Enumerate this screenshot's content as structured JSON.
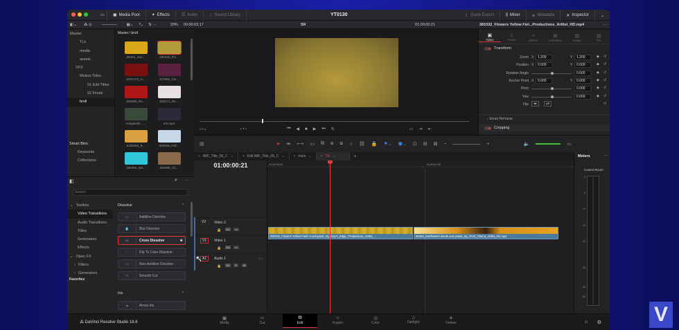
{
  "titlebar": {
    "project": "YT0130",
    "tabs_left": [
      "Media Pool",
      "Effects",
      "Index",
      "Sound Library"
    ],
    "tabs_right": [
      "Quick Export",
      "Mixer",
      "Metadata",
      "Inspector"
    ]
  },
  "toolbar": {
    "zoom": "20%",
    "source_timecode": "00:00:03:17",
    "timeline_name": "SR",
    "record_timecode": "01:00:00:21",
    "inspector_clip": "281032_Flowers Yellow Fiel...Productions_Artlist_HD.mp4"
  },
  "media_pool": {
    "path": "Master / broll",
    "tree": [
      "Master",
      "TLs",
      "media",
      "assets",
      "VFX",
      "Motion Titles",
      "01 Edit Titles",
      "02 Finals",
      "broll"
    ],
    "selected": "broll",
    "smart_bins": "Smart Bins",
    "smart_items": [
      "Keywords",
      "Collections"
    ],
    "clips": [
      {
        "name": "68454_Sun...",
        "color": "#d8a818"
      },
      {
        "name": "281032_Flo...",
        "color": "#b09a3a"
      },
      {
        "name": "6201272_H...",
        "color": "#7a1010"
      },
      {
        "name": "427590_Clo...",
        "color": "#5a2040"
      },
      {
        "name": "555069_Re...",
        "color": "#b01818"
      },
      {
        "name": "556271_Re...",
        "color": "#e8e0e0"
      },
      {
        "name": "Kolyakolis - ...",
        "color": "#3a4a3a"
      },
      {
        "name": "sr3.mp4",
        "color": "#2a2a3a"
      },
      {
        "name": "6180460_E...",
        "color": "#d8a040"
      },
      {
        "name": "556555_Fall...",
        "color": "#c8d8e8"
      },
      {
        "name": "250456_Div...",
        "color": "#30c8d8"
      },
      {
        "name": "692585_Cit...",
        "color": "#8a6a4a"
      }
    ]
  },
  "effects": {
    "search_placeholder": "Search",
    "toolbox": [
      "Toolbox",
      "Video Transitions",
      "Audio Transitions",
      "Titles",
      "Generators",
      "Effects",
      "Open FX",
      "Filters",
      "Generators"
    ],
    "selected": "Video Transitions",
    "favorites": "Favorites",
    "section": "Dissolve",
    "items": [
      "Additive Dissolve",
      "Blur Dissolve",
      "Cross Dissolve",
      "Dip To Color Dissolve",
      "Non-Additive Dissolve",
      "Smooth Cut"
    ],
    "highlighted": "Cross Dissolve",
    "section2": "Iris",
    "items2": [
      "Arrow Iris"
    ]
  },
  "inspector": {
    "tabs": [
      "Video",
      "Audio",
      "Effects",
      "Transition",
      "Image",
      "File"
    ],
    "active_tab": "Video",
    "transform": "Transform",
    "params": [
      {
        "label": "Zoom",
        "x": "1.200",
        "y": "1.200"
      },
      {
        "label": "Position",
        "x": "0.000",
        "y": "0.000"
      },
      {
        "label": "Rotation Angle",
        "value": "0.000"
      },
      {
        "label": "Anchor Point",
        "x": "0.000",
        "y": "0.000"
      },
      {
        "label": "Pitch",
        "value": "0.000"
      },
      {
        "label": "Yaw",
        "value": "0.000"
      },
      {
        "label": "Flip"
      }
    ],
    "smart_reframe": "Smart Reframe",
    "cropping": "Cropping"
  },
  "timeline": {
    "tabs": [
      "IMK_Title_06_C",
      "Edit IMK_Title_06_C",
      "main",
      "SR"
    ],
    "active_tab": "SR",
    "timecode": "01:00:00:21",
    "ruler": [
      "01:00:00:00",
      "01:00:02:00"
    ],
    "tracks": [
      {
        "id": "V2",
        "name": "Video 2"
      },
      {
        "id": "V1",
        "name": "Video 1"
      },
      {
        "id": "A1",
        "name": "Audio 1",
        "ch": "2.0"
      }
    ],
    "clips": [
      "281032_Flowers Yellow Field Countryside_By_Day's_Edge_Productions_Artlist_...",
      "68454_Sunflowers seeds and petals_By_Omri_Ohana_Artlist_HD.mp4"
    ],
    "playhead_position": "01:00:00:21"
  },
  "meters": {
    "title": "Meters",
    "room": "Control Room",
    "scale": [
      "0",
      "-5",
      "-10",
      "-15",
      "-20",
      "-30",
      "-40",
      "-50"
    ]
  },
  "bottom": {
    "app": "DaVinci Resolve Studio 18.6",
    "pages": [
      "Media",
      "Cut",
      "Edit",
      "Fusion",
      "Color",
      "Fairlight",
      "Deliver"
    ],
    "active": "Edit"
  },
  "colors": {
    "accent": "#e53935",
    "clip": "#4b7a9a",
    "bg": "#1f1f22"
  }
}
